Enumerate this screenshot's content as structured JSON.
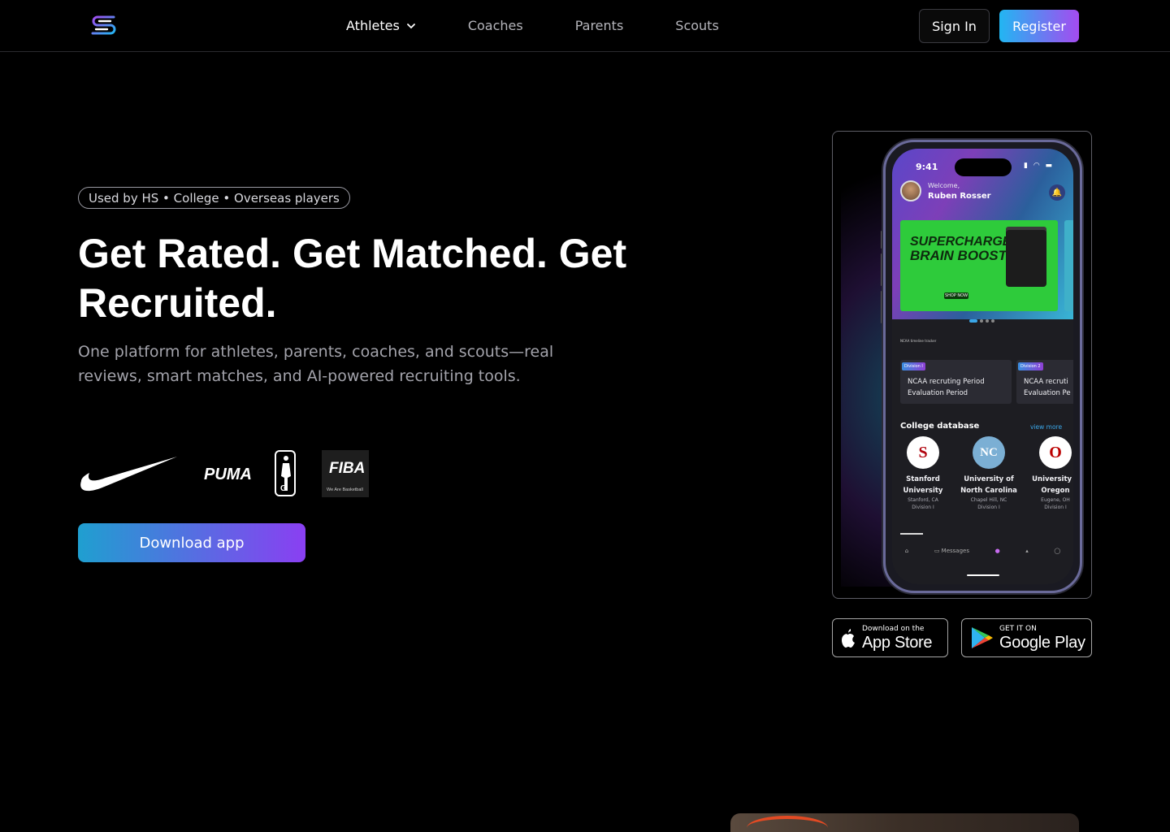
{
  "nav": {
    "items": [
      {
        "label": "Athletes",
        "active": true,
        "has_dropdown": true
      },
      {
        "label": "Coaches"
      },
      {
        "label": "Parents"
      },
      {
        "label": "Scouts"
      }
    ],
    "sign_in": "Sign In",
    "register": "Register"
  },
  "hero": {
    "pill": "Used by HS • College • Overseas players",
    "headline": "Get Rated. Get Matched. Get Recruited.",
    "subtitle": "One platform for athletes, parents, coaches, and scouts—real reviews, smart matches, and AI-powered recruiting tools.",
    "brands": [
      "Nike",
      "PUMA",
      "G League",
      "FIBA"
    ],
    "brand_labels": {
      "puma": "PUMA",
      "fiba": "FIBA",
      "fiba_tag": "We Are Basketball"
    },
    "download": "Download app"
  },
  "phone": {
    "time": "9:41",
    "welcome": "Welcome,",
    "user": "Ruben Rosser",
    "banner_line1": "SUPERCHARGED",
    "banner_line2": "BRAIN BOOST",
    "banner_button": "SHOP NOW",
    "section_tracker": "NCAA timeline tracker",
    "events": [
      {
        "tag": "Division I",
        "line1": "NCAA recruting Period",
        "line2": "Evaluation Period"
      },
      {
        "tag": "Division 2",
        "line1": "NCAA recruti",
        "line2": "Evaluation Pe"
      }
    ],
    "college_header": "College database",
    "view_more": "view more",
    "colleges": [
      {
        "name1": "Stanford",
        "name2": "University",
        "loc": "Stanford, CA",
        "div": "Division I",
        "mark": "S",
        "color": "#b1040e"
      },
      {
        "name1": "University of",
        "name2": "North Carolina",
        "loc": "Chapel Hill, NC",
        "div": "Division I",
        "mark": "NC",
        "color": "#7bafd4"
      },
      {
        "name1": "University o",
        "name2": "Oregon",
        "loc": "Eugene, OH",
        "div": "Division I",
        "mark": "O",
        "color": "#bb0000"
      }
    ],
    "tab_messages": "Messages"
  },
  "stores": {
    "apple_small": "Download on the",
    "apple_big": "App Store",
    "google_small": "GET IT ON",
    "google_big": "Google Play"
  },
  "colors": {
    "accent_start": "#22b6f2",
    "accent_end": "#a44bf0",
    "background": "#000000"
  }
}
